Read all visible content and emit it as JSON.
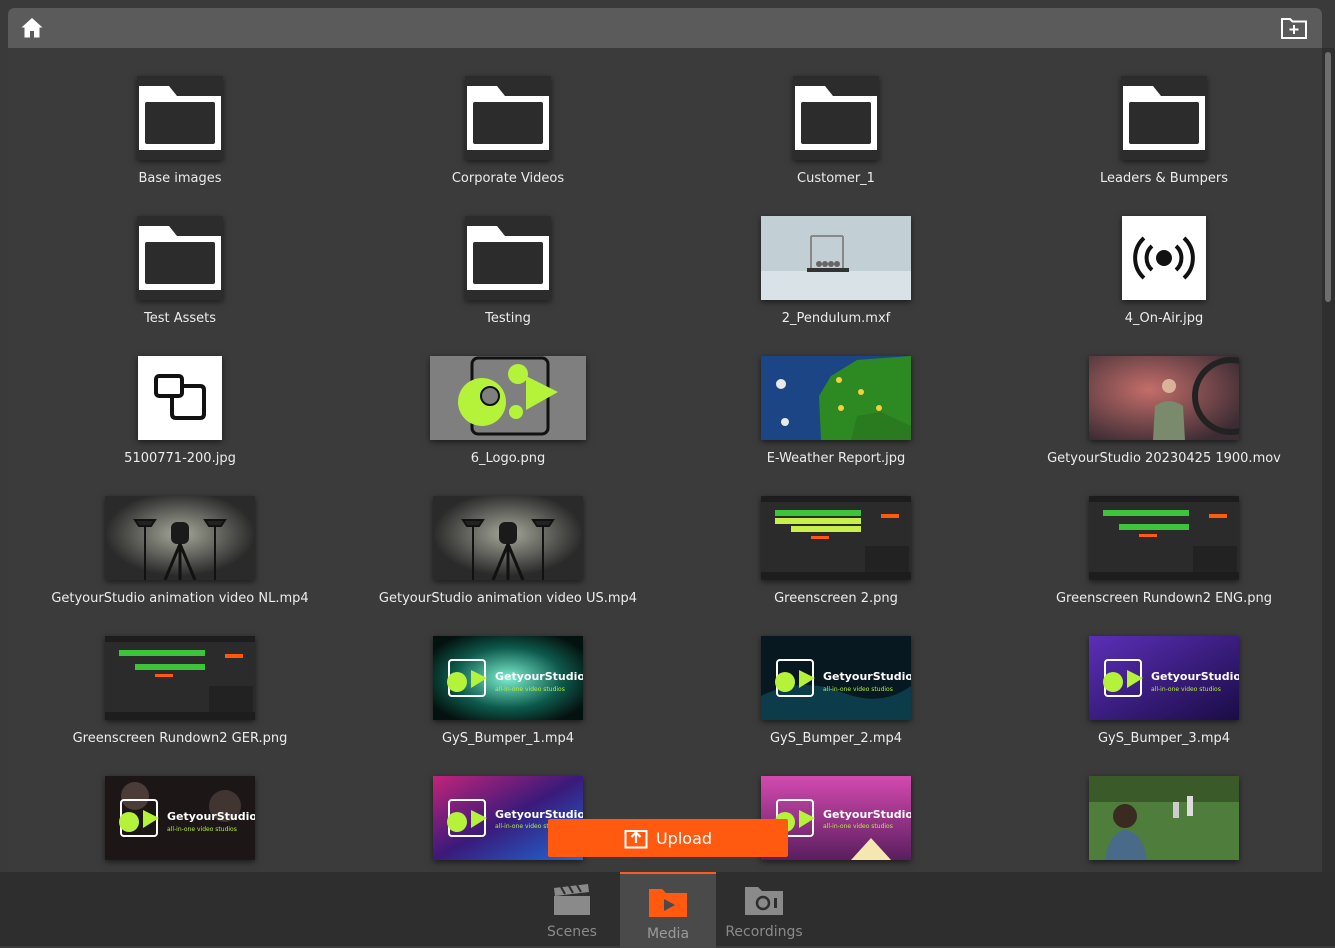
{
  "header": {
    "home_icon": "home-icon",
    "new_folder_icon": "new-folder-icon"
  },
  "items": [
    {
      "name": "Base images",
      "kind": "folder"
    },
    {
      "name": "Corporate Videos",
      "kind": "folder"
    },
    {
      "name": "Customer_1",
      "kind": "folder"
    },
    {
      "name": "Leaders & Bumpers",
      "kind": "folder"
    },
    {
      "name": "Test Assets",
      "kind": "folder"
    },
    {
      "name": "Testing",
      "kind": "folder"
    },
    {
      "name": "2_Pendulum.mxf",
      "kind": "video"
    },
    {
      "name": "4_On-Air.jpg",
      "kind": "image"
    },
    {
      "name": "5100771-200.jpg",
      "kind": "image"
    },
    {
      "name": "6_Logo.png",
      "kind": "image"
    },
    {
      "name": "E-Weather Report.jpg",
      "kind": "image"
    },
    {
      "name": "GetyourStudio 20230425 1900.mov",
      "kind": "video"
    },
    {
      "name": "GetyourStudio animation video NL.mp4",
      "kind": "video"
    },
    {
      "name": "GetyourStudio animation video US.mp4",
      "kind": "video"
    },
    {
      "name": "Greenscreen 2.png",
      "kind": "image"
    },
    {
      "name": "Greenscreen Rundown2 ENG.png",
      "kind": "image"
    },
    {
      "name": "Greenscreen Rundown2 GER.png",
      "kind": "image"
    },
    {
      "name": "GyS_Bumper_1.mp4",
      "kind": "video"
    },
    {
      "name": "GyS_Bumper_2.mp4",
      "kind": "video"
    },
    {
      "name": "GyS_Bumper_3.mp4",
      "kind": "video"
    },
    {
      "name": "",
      "kind": "video"
    },
    {
      "name": "",
      "kind": "video"
    },
    {
      "name": "",
      "kind": "video"
    },
    {
      "name": "",
      "kind": "video"
    }
  ],
  "thumb_text": {
    "brand_name": "GetyourStudio",
    "brand_tagline": "all-in-one video studios"
  },
  "upload": {
    "label": "Upload"
  },
  "tabs": [
    {
      "label": "Scenes",
      "active": false
    },
    {
      "label": "Media",
      "active": true
    },
    {
      "label": "Recordings",
      "active": false
    }
  ],
  "colors": {
    "accent": "#ff5a0f",
    "logo_green": "#b5f23a"
  }
}
